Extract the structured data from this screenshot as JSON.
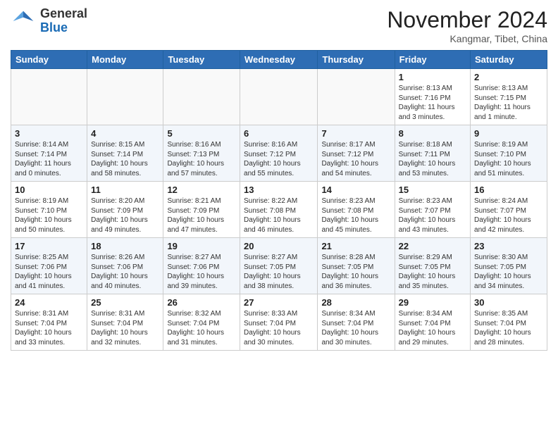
{
  "header": {
    "logo_line1": "General",
    "logo_line2": "Blue",
    "month": "November 2024",
    "location": "Kangmar, Tibet, China"
  },
  "days_of_week": [
    "Sunday",
    "Monday",
    "Tuesday",
    "Wednesday",
    "Thursday",
    "Friday",
    "Saturday"
  ],
  "weeks": [
    [
      {
        "day": "",
        "info": ""
      },
      {
        "day": "",
        "info": ""
      },
      {
        "day": "",
        "info": ""
      },
      {
        "day": "",
        "info": ""
      },
      {
        "day": "",
        "info": ""
      },
      {
        "day": "1",
        "info": "Sunrise: 8:13 AM\nSunset: 7:16 PM\nDaylight: 11 hours\nand 3 minutes."
      },
      {
        "day": "2",
        "info": "Sunrise: 8:13 AM\nSunset: 7:15 PM\nDaylight: 11 hours\nand 1 minute."
      }
    ],
    [
      {
        "day": "3",
        "info": "Sunrise: 8:14 AM\nSunset: 7:14 PM\nDaylight: 11 hours\nand 0 minutes."
      },
      {
        "day": "4",
        "info": "Sunrise: 8:15 AM\nSunset: 7:14 PM\nDaylight: 10 hours\nand 58 minutes."
      },
      {
        "day": "5",
        "info": "Sunrise: 8:16 AM\nSunset: 7:13 PM\nDaylight: 10 hours\nand 57 minutes."
      },
      {
        "day": "6",
        "info": "Sunrise: 8:16 AM\nSunset: 7:12 PM\nDaylight: 10 hours\nand 55 minutes."
      },
      {
        "day": "7",
        "info": "Sunrise: 8:17 AM\nSunset: 7:12 PM\nDaylight: 10 hours\nand 54 minutes."
      },
      {
        "day": "8",
        "info": "Sunrise: 8:18 AM\nSunset: 7:11 PM\nDaylight: 10 hours\nand 53 minutes."
      },
      {
        "day": "9",
        "info": "Sunrise: 8:19 AM\nSunset: 7:10 PM\nDaylight: 10 hours\nand 51 minutes."
      }
    ],
    [
      {
        "day": "10",
        "info": "Sunrise: 8:19 AM\nSunset: 7:10 PM\nDaylight: 10 hours\nand 50 minutes."
      },
      {
        "day": "11",
        "info": "Sunrise: 8:20 AM\nSunset: 7:09 PM\nDaylight: 10 hours\nand 49 minutes."
      },
      {
        "day": "12",
        "info": "Sunrise: 8:21 AM\nSunset: 7:09 PM\nDaylight: 10 hours\nand 47 minutes."
      },
      {
        "day": "13",
        "info": "Sunrise: 8:22 AM\nSunset: 7:08 PM\nDaylight: 10 hours\nand 46 minutes."
      },
      {
        "day": "14",
        "info": "Sunrise: 8:23 AM\nSunset: 7:08 PM\nDaylight: 10 hours\nand 45 minutes."
      },
      {
        "day": "15",
        "info": "Sunrise: 8:23 AM\nSunset: 7:07 PM\nDaylight: 10 hours\nand 43 minutes."
      },
      {
        "day": "16",
        "info": "Sunrise: 8:24 AM\nSunset: 7:07 PM\nDaylight: 10 hours\nand 42 minutes."
      }
    ],
    [
      {
        "day": "17",
        "info": "Sunrise: 8:25 AM\nSunset: 7:06 PM\nDaylight: 10 hours\nand 41 minutes."
      },
      {
        "day": "18",
        "info": "Sunrise: 8:26 AM\nSunset: 7:06 PM\nDaylight: 10 hours\nand 40 minutes."
      },
      {
        "day": "19",
        "info": "Sunrise: 8:27 AM\nSunset: 7:06 PM\nDaylight: 10 hours\nand 39 minutes."
      },
      {
        "day": "20",
        "info": "Sunrise: 8:27 AM\nSunset: 7:05 PM\nDaylight: 10 hours\nand 38 minutes."
      },
      {
        "day": "21",
        "info": "Sunrise: 8:28 AM\nSunset: 7:05 PM\nDaylight: 10 hours\nand 36 minutes."
      },
      {
        "day": "22",
        "info": "Sunrise: 8:29 AM\nSunset: 7:05 PM\nDaylight: 10 hours\nand 35 minutes."
      },
      {
        "day": "23",
        "info": "Sunrise: 8:30 AM\nSunset: 7:05 PM\nDaylight: 10 hours\nand 34 minutes."
      }
    ],
    [
      {
        "day": "24",
        "info": "Sunrise: 8:31 AM\nSunset: 7:04 PM\nDaylight: 10 hours\nand 33 minutes."
      },
      {
        "day": "25",
        "info": "Sunrise: 8:31 AM\nSunset: 7:04 PM\nDaylight: 10 hours\nand 32 minutes."
      },
      {
        "day": "26",
        "info": "Sunrise: 8:32 AM\nSunset: 7:04 PM\nDaylight: 10 hours\nand 31 minutes."
      },
      {
        "day": "27",
        "info": "Sunrise: 8:33 AM\nSunset: 7:04 PM\nDaylight: 10 hours\nand 30 minutes."
      },
      {
        "day": "28",
        "info": "Sunrise: 8:34 AM\nSunset: 7:04 PM\nDaylight: 10 hours\nand 30 minutes."
      },
      {
        "day": "29",
        "info": "Sunrise: 8:34 AM\nSunset: 7:04 PM\nDaylight: 10 hours\nand 29 minutes."
      },
      {
        "day": "30",
        "info": "Sunrise: 8:35 AM\nSunset: 7:04 PM\nDaylight: 10 hours\nand 28 minutes."
      }
    ]
  ]
}
